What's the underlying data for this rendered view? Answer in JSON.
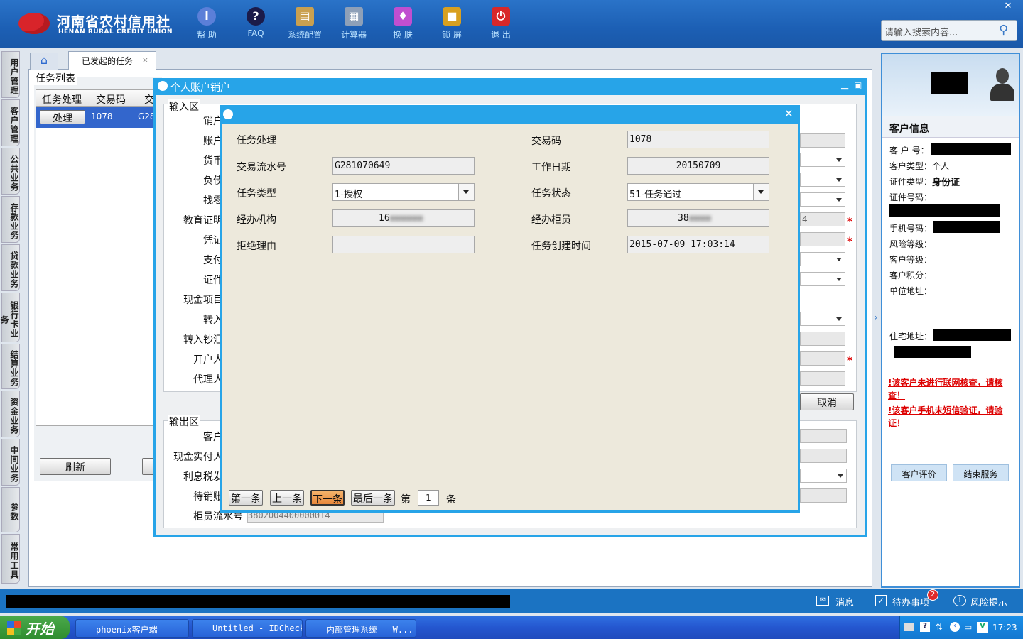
{
  "header": {
    "brand_cn": "河南省农村信用社",
    "brand_en": "HENAN RURAL CREDIT UNION",
    "tools": [
      "帮 助",
      "FAQ",
      "系统配置",
      "计算器",
      "换 肤",
      "锁 屏",
      "退 出"
    ],
    "search_placeholder": "请输入搜索内容...",
    "win_min": "–",
    "win_close": "✕"
  },
  "side_tabs": [
    "用户管理",
    "客户管理",
    "公共业务",
    "存款业务",
    "贷款业务",
    "银行卡业务",
    "结算业务",
    "资金业务",
    "中间业务",
    "参数",
    "常用工具"
  ],
  "tabs": {
    "home_icon": "home-icon",
    "active": "已发起的任务",
    "close": "×"
  },
  "tasklist": {
    "title": "任务列表",
    "columns": [
      "任务处理",
      "交易码",
      "交"
    ],
    "row": {
      "btn": "处理",
      "code": "1078",
      "serial": "G28"
    },
    "refresh": "刷新"
  },
  "dialog1": {
    "title": "个人账户销户",
    "input_area": "输入区",
    "input_labels": [
      "销户",
      "账户",
      "货币",
      "负债",
      "找零",
      "教育证明",
      "凭证",
      "支付",
      "证件",
      "现金项目",
      "转入",
      "转入钞汇",
      "开户人",
      "代理人"
    ],
    "partial_value": "4",
    "cancel": "取消",
    "output_area": "输出区",
    "output_labels": [
      "客户",
      "现金实付人",
      "利息税发",
      "待销账",
      "柜员流水号"
    ],
    "teller_serial": "3802004400000014"
  },
  "popup": {
    "close": "✕",
    "fields": {
      "task_proc": "任务处理",
      "tx_code_label": "交易码",
      "tx_code": "1078",
      "serial_label": "交易流水号",
      "serial": "G281070649",
      "work_date_label": "工作日期",
      "work_date": "20150709",
      "task_type_label": "任务类型",
      "task_type": "1-授权",
      "task_status_label": "任务状态",
      "task_status": "51-任务通过",
      "org_label": "经办机构",
      "org": "16",
      "teller_label": "经办柜员",
      "teller": "38",
      "reject_label": "拒绝理由",
      "reject": "",
      "created_label": "任务创建时间",
      "created": "2015-07-09 17:03:14"
    },
    "nav": {
      "first": "第一条",
      "prev": "上一条",
      "next": "下一条",
      "last": "最后一条",
      "page_prefix": "第",
      "page": "1",
      "page_suffix": "条"
    }
  },
  "customer": {
    "title": "客户信息",
    "id_label": "客 户 号：",
    "type_label": "客户类型：",
    "type": "个人",
    "cert_type_label": "证件类型：",
    "cert_type": "身份证",
    "cert_no_label": "证件号码：",
    "phone_label": "手机号码：",
    "risk_label": "风险等级：",
    "level_label": "客户等级：",
    "points_label": "客户积分：",
    "work_addr_label": "单位地址：",
    "home_addr_label": "住宅地址：",
    "warn1": "!该客户未进行联网核查，请核查！",
    "warn2": "!该客户手机未短信验证，请验证！",
    "eval_btn": "客户评价",
    "end_btn": "结束服务"
  },
  "statusbar": {
    "msg": "消息",
    "todo": "待办事项",
    "todo_count": "2",
    "risk": "风险提示"
  },
  "taskbar": {
    "start": "开始",
    "items": [
      "phoenix客户端",
      "Untitled - IDCheck",
      "内部管理系统 - W..."
    ],
    "clock": "17:23"
  },
  "colors": {
    "accent": "#27a4e8",
    "header": "#1c5fb4",
    "warning": "#dd0000"
  }
}
